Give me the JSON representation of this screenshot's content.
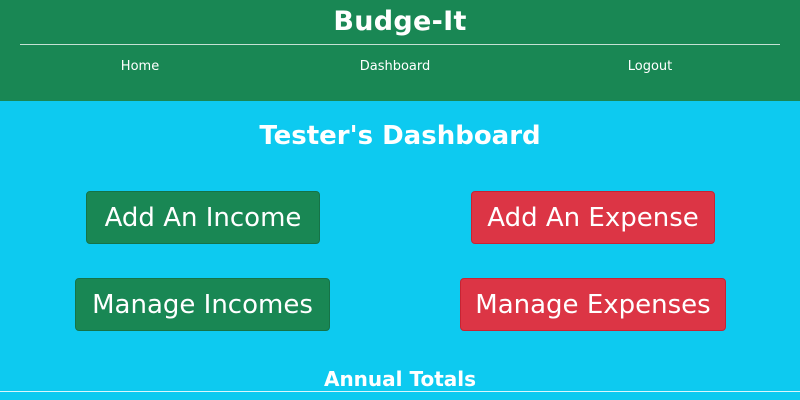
{
  "header": {
    "brand": "Budge-It",
    "nav": {
      "home": "Home",
      "dashboard": "Dashboard",
      "logout": "Logout"
    }
  },
  "main": {
    "title": "Tester's Dashboard",
    "buttons": {
      "add_income": "Add An Income",
      "add_expense": "Add An Expense",
      "manage_incomes": "Manage Incomes",
      "manage_expenses": "Manage Expenses"
    },
    "section_title": "Annual Totals"
  },
  "colors": {
    "header_bg": "#198754",
    "main_bg": "#0dcaf0",
    "income_button": "#198754",
    "expense_button": "#dc3545",
    "text": "#ffffff"
  }
}
